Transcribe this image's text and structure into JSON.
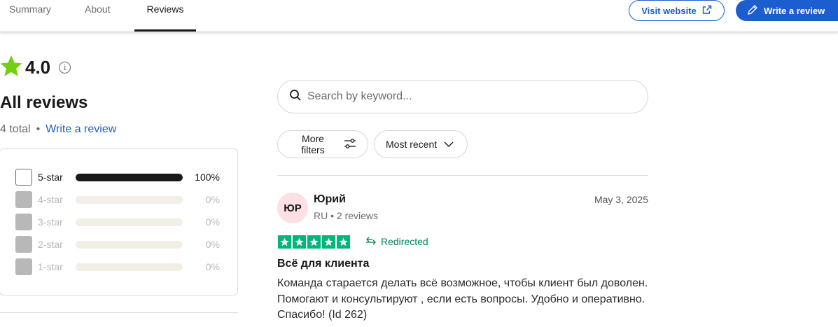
{
  "nav": {
    "tabs": [
      {
        "label": "Summary",
        "active": false
      },
      {
        "label": "About",
        "active": false
      },
      {
        "label": "Reviews",
        "active": true
      }
    ],
    "visit_website_label": "Visit website",
    "write_review_label": "Write a review"
  },
  "summary": {
    "rating": "4.0",
    "star_color": "#73cf11",
    "heading": "All reviews",
    "total_text": "4 total",
    "separator": "•",
    "write_review_link": "Write a review"
  },
  "distribution": [
    {
      "label": "5-star",
      "percent": 100,
      "percent_text": "100%",
      "checked": false,
      "enabled": true
    },
    {
      "label": "4-star",
      "percent": 0,
      "percent_text": "0%",
      "checked": false,
      "enabled": false
    },
    {
      "label": "3-star",
      "percent": 0,
      "percent_text": "0%",
      "checked": false,
      "enabled": false
    },
    {
      "label": "2-star",
      "percent": 0,
      "percent_text": "0%",
      "checked": false,
      "enabled": false
    },
    {
      "label": "1-star",
      "percent": 0,
      "percent_text": "0%",
      "checked": false,
      "enabled": false
    }
  ],
  "search": {
    "placeholder": "Search by keyword..."
  },
  "filters": {
    "more_filters_label": "More filters",
    "sort_label": "Most recent"
  },
  "review": {
    "avatar_initials": "ЮР",
    "avatar_color": "#fde0e3",
    "reviewer_name": "Юрий",
    "reviewer_meta": "RU • 2 reviews",
    "date": "May 3, 2025",
    "stars": 5,
    "star_color": "#00b67a",
    "redirected_label": "Redirected",
    "title": "Всё для клиента",
    "body": "Команда старается делать всё возможное, чтобы клиент был доволен. Помогают и консультируют , если есть вопросы. Удобно и оперативно. Спасибо! (Id 262)"
  },
  "colors": {
    "accent": "#1c5ecf",
    "text": "#191919",
    "muted": "#6b6b6b",
    "redirect_green": "#04825c"
  }
}
